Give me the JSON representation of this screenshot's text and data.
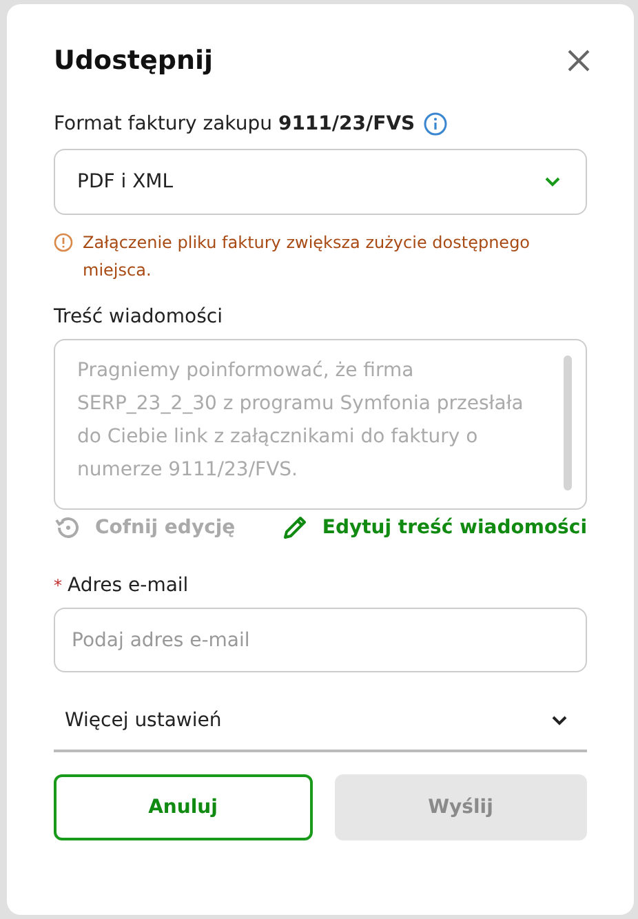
{
  "dialog": {
    "title": "Udostępnij"
  },
  "format": {
    "label": "Format faktury zakupu **9111/23/FVS**",
    "value": "PDF i XML",
    "warning": "Załączenie pliku faktury zwiększa zużycie dostępnego miejsca."
  },
  "message": {
    "label": "Treść wiadomości",
    "value": "Pragniemy poinformować, że firma SERP_23_2_30 z programu Symfonia przesłała do Ciebie link z załącznikami do faktury o numerze 9111/23/FVS.",
    "disabled": true
  },
  "message_actions": [
    {
      "label": "Cofnij edycję",
      "kind": "undo",
      "disabled": true
    },
    {
      "label": "Edytuj treść wiadomości",
      "kind": "edit",
      "disabled": false
    }
  ],
  "email": {
    "required_mark": "*",
    "label": "Adres e-mail",
    "placeholder": "Podaj adres e-mail"
  },
  "more_settings": {
    "label": "Więcej ustawień",
    "expanded": false
  },
  "buttons": [
    {
      "label": "Anuluj",
      "kind": "secondary",
      "disabled": false
    },
    {
      "label": "Wyślij",
      "kind": "primary",
      "disabled": true
    }
  ]
}
